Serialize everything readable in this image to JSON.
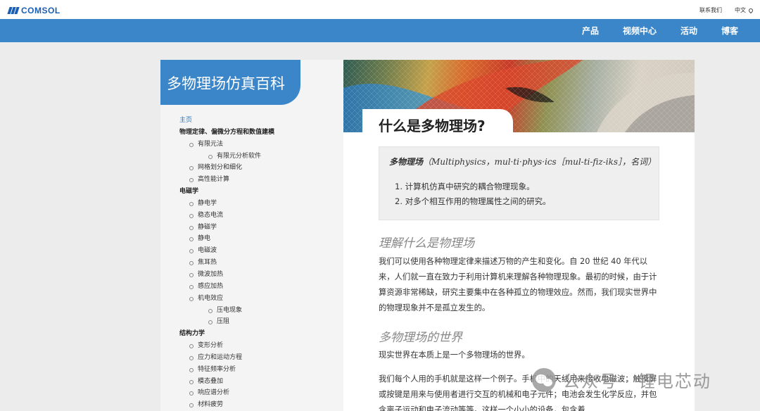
{
  "topbar": {
    "logo_text": "COMSOL",
    "contact": "联系我们",
    "language": "中文"
  },
  "nav": {
    "items": [
      "产品",
      "视频中心",
      "活动",
      "博客"
    ]
  },
  "sidebar": {
    "title": "多物理场仿真百科",
    "toc": [
      {
        "label": "主页",
        "level": "home"
      },
      {
        "label": "物理定律、偏微分方程和数值建模",
        "level": "section"
      },
      {
        "label": "有限元法",
        "level": "l1"
      },
      {
        "label": "有限元分析软件",
        "level": "l2"
      },
      {
        "label": "网格划分和细化",
        "level": "l1"
      },
      {
        "label": "高性能计算",
        "level": "l1"
      },
      {
        "label": "电磁学",
        "level": "section"
      },
      {
        "label": "静电学",
        "level": "l1"
      },
      {
        "label": "稳态电流",
        "level": "l1"
      },
      {
        "label": "静磁学",
        "level": "l1"
      },
      {
        "label": "静电",
        "level": "l1"
      },
      {
        "label": "电磁波",
        "level": "l1"
      },
      {
        "label": "焦耳热",
        "level": "l1"
      },
      {
        "label": "微波加热",
        "level": "l1"
      },
      {
        "label": "感应加热",
        "level": "l1"
      },
      {
        "label": "机电效应",
        "level": "l1"
      },
      {
        "label": "压电现象",
        "level": "l2"
      },
      {
        "label": "压阻",
        "level": "l2"
      },
      {
        "label": "结构力学",
        "level": "section"
      },
      {
        "label": "变形分析",
        "level": "l1"
      },
      {
        "label": "应力和运动方程",
        "level": "l1"
      },
      {
        "label": "特征频率分析",
        "level": "l1"
      },
      {
        "label": "模态叠加",
        "level": "l1"
      },
      {
        "label": "响应谱分析",
        "level": "l1"
      },
      {
        "label": "材料疲劳",
        "level": "l1"
      }
    ]
  },
  "content": {
    "page_title": "什么是多物理场?",
    "definition": {
      "term": "多物理场",
      "pronunciation": "（Multiphysics，mul·ti·phys·ics［mul-ti-fiz-iks］，名词）",
      "items": [
        "1. 计算机仿真中研究的耦合物理现象。",
        "2. 对多个相互作用的物理属性之间的研究。"
      ]
    },
    "section1": {
      "heading": "理解什么是物理场",
      "paragraph": "我们可以使用各种物理定律来描述万物的产生和变化。自 20 世纪 40 年代以来，人们就一直在致力于利用计算机来理解各种物理现象。最初的时候，由于计算资源非常稀缺，研究主要集中在各种孤立的物理效应。然而，我们现实世界中的物理现象并不是孤立发生的。"
    },
    "section2": {
      "heading": "多物理场的世界",
      "paragraph1": "现实世界在本质上是一个多物理场的世界。",
      "paragraph2": "我们每个人用的手机就是这样一个例子。手机中的天线用来接收电磁波；触摸屏或按键是用来与使用者进行交互的机械和电子元件；电池会发生化学反应，并包含离子运动和电子流动等等。这样一个小小的设备，包含着"
    }
  },
  "watermark": {
    "text": "公众号 · 锂电芯动"
  }
}
